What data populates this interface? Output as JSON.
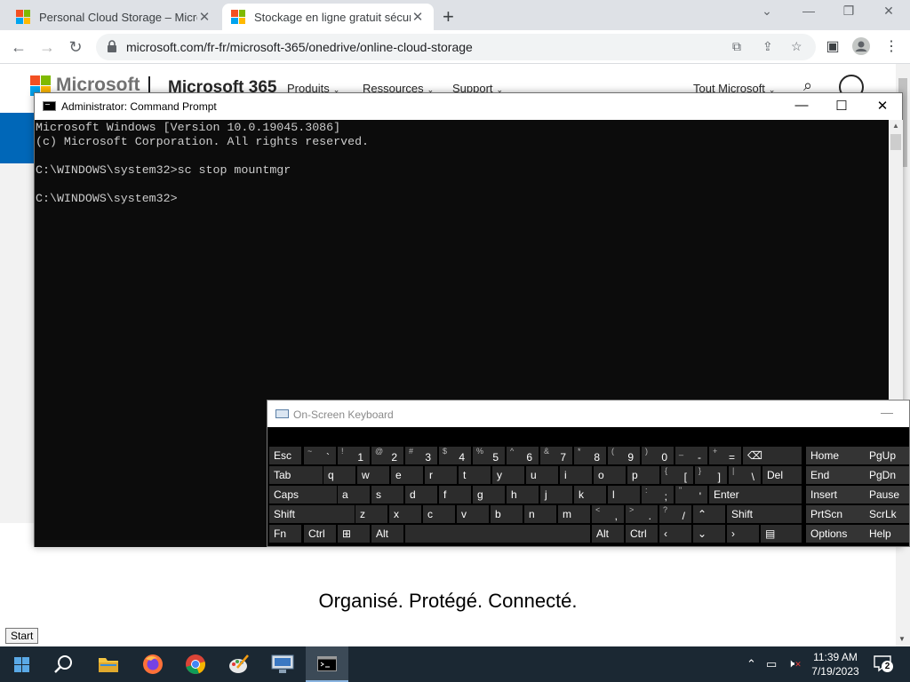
{
  "browser": {
    "tabs": [
      {
        "title": "Personal Cloud Storage – Micros",
        "active": false
      },
      {
        "title": "Stockage en ligne gratuit sécuris",
        "active": true
      }
    ],
    "new_tab_symbol": "+",
    "window_controls": {
      "tab_search": "⌄",
      "minimize": "—",
      "restore": "❐",
      "close": "✕"
    },
    "url": "microsoft.com/fr-fr/microsoft-365/onedrive/online-cloud-storage",
    "nav": {
      "back": "←",
      "forward": "→",
      "reload": "↻"
    },
    "toolbar_icons": [
      "translate-icon",
      "share-icon",
      "star-icon",
      "sidebar-icon",
      "profile-icon",
      "menu-icon"
    ]
  },
  "page": {
    "brand": "Microsoft",
    "product": "Microsoft 365",
    "nav": [
      "Produits",
      "Ressources",
      "Support"
    ],
    "all_microsoft": "Tout Microsoft",
    "hero": "Organisé. Protégé. Connecté.",
    "colors": {
      "accent_blue": "#0067b8",
      "ms_red": "#f25022",
      "ms_green": "#7fba00",
      "ms_blue": "#00a4ef",
      "ms_yellow": "#ffb900"
    }
  },
  "cmd": {
    "title": "Administrator: Command Prompt",
    "controls": {
      "minimize": "—",
      "maximize": "☐",
      "close": "✕"
    },
    "lines": [
      "Microsoft Windows [Version 10.0.19045.3086]",
      "(c) Microsoft Corporation. All rights reserved.",
      "",
      "C:\\WINDOWS\\system32>sc stop mountmgr",
      "",
      "C:\\WINDOWS\\system32>"
    ]
  },
  "osk": {
    "title": "On-Screen Keyboard",
    "minimize": "—",
    "rows": [
      [
        {
          "m": "Esc"
        },
        {
          "m": "`",
          "s": "~"
        },
        {
          "m": "1",
          "s": "!"
        },
        {
          "m": "2",
          "s": "@"
        },
        {
          "m": "3",
          "s": "#"
        },
        {
          "m": "4",
          "s": "$"
        },
        {
          "m": "5",
          "s": "%"
        },
        {
          "m": "6",
          "s": "^"
        },
        {
          "m": "7",
          "s": "&"
        },
        {
          "m": "8",
          "s": "*"
        },
        {
          "m": "9",
          "s": "("
        },
        {
          "m": "0",
          "s": ")"
        },
        {
          "m": "-",
          "s": "_"
        },
        {
          "m": "=",
          "s": "+"
        },
        {
          "m": "⌫"
        },
        {
          "m": "Home"
        },
        {
          "m": "PgUp"
        }
      ],
      [
        {
          "m": "Tab"
        },
        {
          "m": "q"
        },
        {
          "m": "w"
        },
        {
          "m": "e"
        },
        {
          "m": "r"
        },
        {
          "m": "t"
        },
        {
          "m": "y"
        },
        {
          "m": "u"
        },
        {
          "m": "i"
        },
        {
          "m": "o"
        },
        {
          "m": "p"
        },
        {
          "m": "[",
          "s": "{"
        },
        {
          "m": "]",
          "s": "}"
        },
        {
          "m": "\\",
          "s": "|"
        },
        {
          "m": "Del"
        },
        {
          "m": "End"
        },
        {
          "m": "PgDn"
        }
      ],
      [
        {
          "m": "Caps"
        },
        {
          "m": "a"
        },
        {
          "m": "s"
        },
        {
          "m": "d"
        },
        {
          "m": "f"
        },
        {
          "m": "g"
        },
        {
          "m": "h"
        },
        {
          "m": "j"
        },
        {
          "m": "k"
        },
        {
          "m": "l"
        },
        {
          "m": ";",
          "s": ":"
        },
        {
          "m": "'",
          "s": "\""
        },
        {
          "m": "Enter"
        },
        {
          "m": "Insert"
        },
        {
          "m": "Pause"
        }
      ],
      [
        {
          "m": "Shift"
        },
        {
          "m": "z"
        },
        {
          "m": "x"
        },
        {
          "m": "c"
        },
        {
          "m": "v"
        },
        {
          "m": "b"
        },
        {
          "m": "n"
        },
        {
          "m": "m"
        },
        {
          "m": ",",
          "s": "<"
        },
        {
          "m": ".",
          "s": ">"
        },
        {
          "m": "/",
          "s": "?"
        },
        {
          "m": "⌃"
        },
        {
          "m": "Shift"
        },
        {
          "m": "PrtScn"
        },
        {
          "m": "ScrLk"
        }
      ],
      [
        {
          "m": "Fn"
        },
        {
          "m": "Ctrl"
        },
        {
          "m": "⊞"
        },
        {
          "m": "Alt"
        },
        {
          "m": ""
        },
        {
          "m": "Alt"
        },
        {
          "m": "Ctrl"
        },
        {
          "m": "‹"
        },
        {
          "m": "⌄"
        },
        {
          "m": "›"
        },
        {
          "m": "▤"
        },
        {
          "m": "Options"
        },
        {
          "m": "Help"
        }
      ]
    ]
  },
  "taskbar": {
    "tooltip": "Start",
    "time": "11:39 AM",
    "date": "7/19/2023",
    "notifications": "2",
    "apps": [
      "start-icon",
      "search-icon",
      "file-explorer-icon",
      "firefox-icon",
      "chrome-icon",
      "paint-icon",
      "remote-desktop-icon",
      "cmd-icon"
    ]
  }
}
